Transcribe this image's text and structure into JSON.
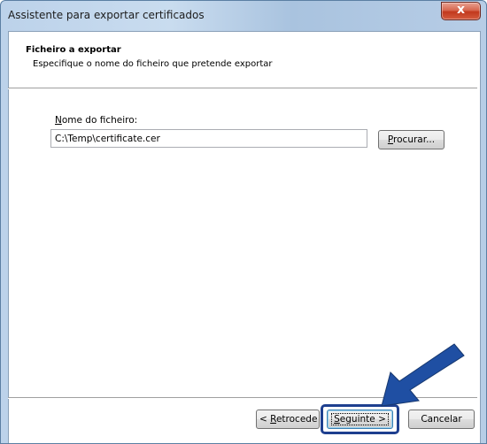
{
  "window": {
    "title": "Assistente para exportar certificados",
    "close_glyph": "x"
  },
  "header": {
    "title": "Ficheiro a exportar",
    "subtitle": "Especifique o nome do ficheiro que pretende exportar"
  },
  "form": {
    "label_prefix": "N",
    "label_rest": "ome do ficheiro:",
    "file_value": "C:\\Temp\\certificate.cer",
    "browse_prefix": "P",
    "browse_rest": "rocurar..."
  },
  "footer": {
    "back_prefix": "< ",
    "back_mnemonic": "R",
    "back_rest": "etrocede",
    "next_mnemonic": "S",
    "next_rest": "eguinte >",
    "cancel_label": "Cancelar"
  },
  "annotation": {
    "arrow_color": "#1f4fa3",
    "highlight_color": "#1e3f8f"
  }
}
